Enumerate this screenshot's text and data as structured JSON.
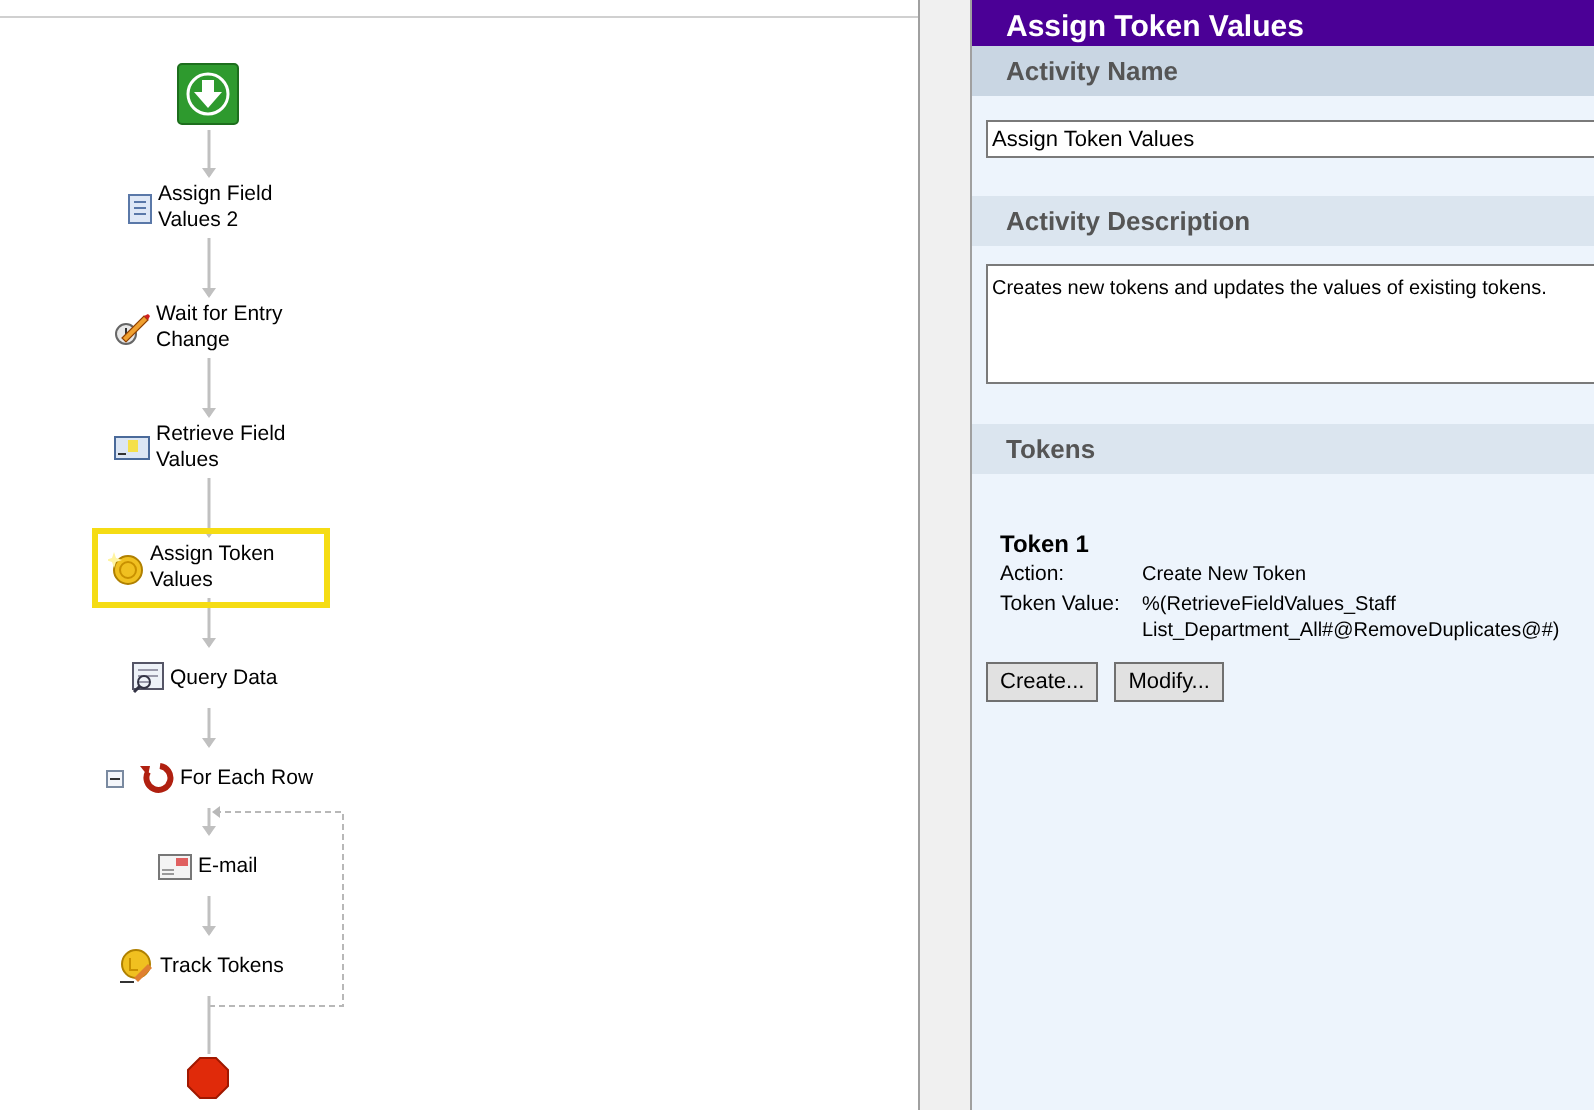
{
  "workflow": {
    "nodes": [
      {
        "kind": "start",
        "selected": false
      },
      {
        "kind": "assign-fields",
        "label": "Assign Field Values 2",
        "selected": false
      },
      {
        "kind": "wait",
        "label": "Wait for Entry Change",
        "selected": false
      },
      {
        "kind": "retrieve",
        "label": "Retrieve Field Values",
        "selected": false
      },
      {
        "kind": "assign-token",
        "label": "Assign Token Values",
        "selected": true
      },
      {
        "kind": "query",
        "label": "Query Data",
        "selected": false
      },
      {
        "kind": "loop",
        "label": "For Each Row",
        "selected": false,
        "expanded": true,
        "children": [
          {
            "kind": "email",
            "label": "E-mail",
            "selected": false
          },
          {
            "kind": "track",
            "label": "Track Tokens",
            "selected": false
          }
        ]
      },
      {
        "kind": "stop",
        "selected": false
      }
    ]
  },
  "properties": {
    "title": "Assign Token Values",
    "sections": [
      {
        "kind": "input",
        "heading": "Activity Name",
        "value": "Assign Token Values"
      },
      {
        "kind": "textarea",
        "heading": "Activity Description",
        "value": "Creates new tokens and updates the values of existing tokens."
      },
      {
        "kind": "tokens",
        "heading": "Tokens",
        "tokens": [
          {
            "title": "Token 1",
            "fields": [
              {
                "label": "Action:",
                "value": "Create New Token"
              },
              {
                "label": "Token Value:",
                "value": "%(RetrieveFieldValues_Staff List_Department_All#@RemoveDuplicates@#)"
              }
            ]
          }
        ],
        "buttons": [
          "Create...",
          "Modify..."
        ]
      }
    ]
  }
}
